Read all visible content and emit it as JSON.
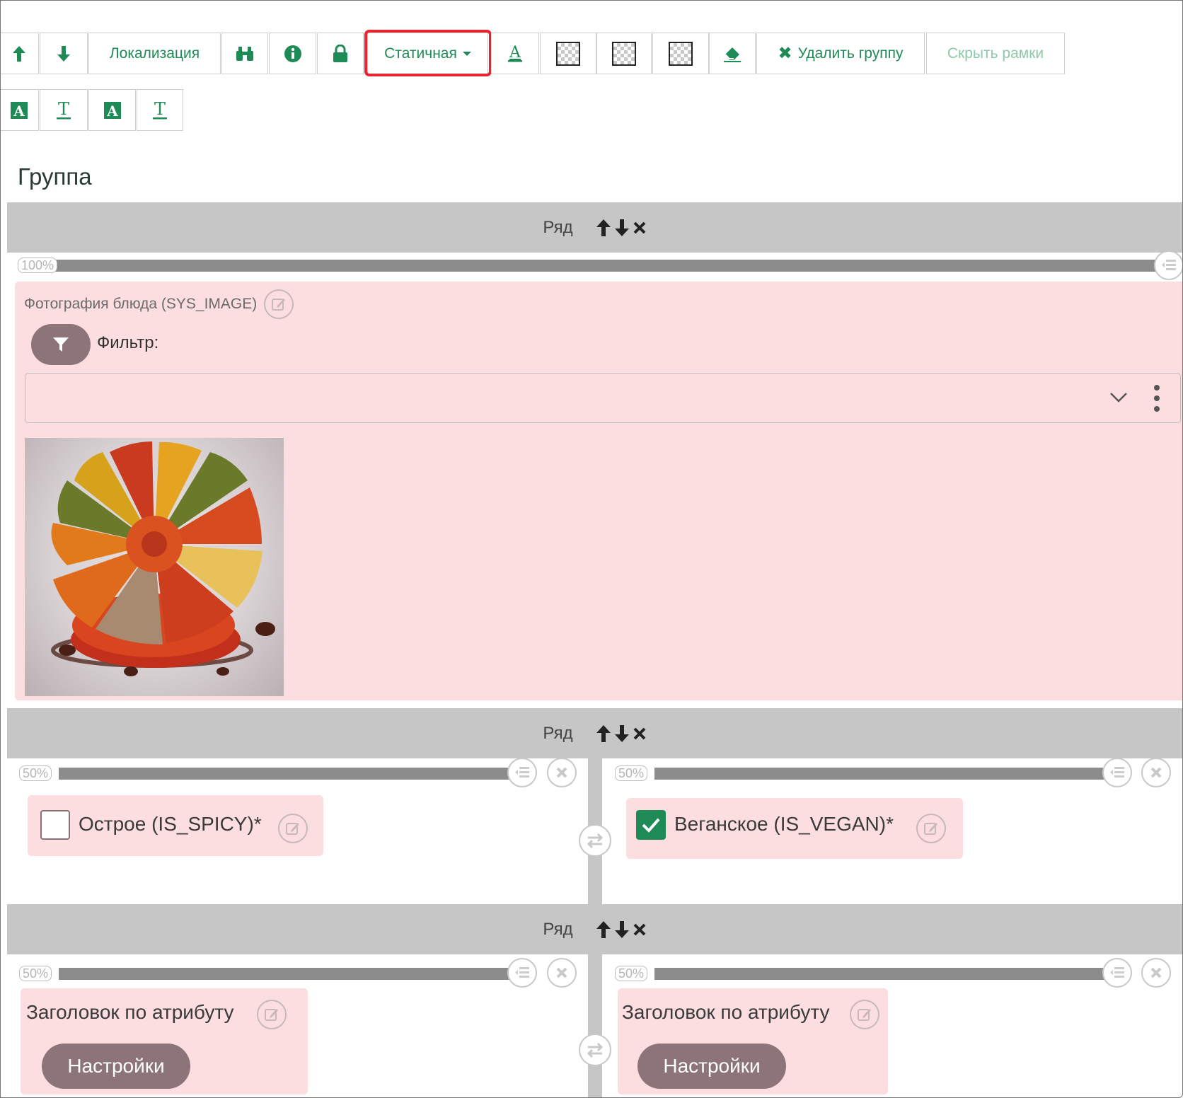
{
  "toolbar": {
    "localization_label": "Локализация",
    "static_label": "Статичная",
    "delete_group_label": "Удалить группу",
    "hide_frames_label": "Скрыть рамки"
  },
  "group": {
    "title": "Группа"
  },
  "rows": [
    {
      "label": "Ряд",
      "columns": [
        {
          "width_label": "100%",
          "field_label": "Фотография блюда (SYS_IMAGE)",
          "filter_label": "Фильтр:",
          "select_value": ""
        }
      ]
    },
    {
      "label": "Ряд",
      "columns": [
        {
          "width_label": "50%",
          "checkbox_label": "Острое (IS_SPICY)*",
          "checked": false
        },
        {
          "width_label": "50%",
          "checkbox_label": "Веганское (IS_VEGAN)*",
          "checked": true
        }
      ]
    },
    {
      "label": "Ряд",
      "columns": [
        {
          "width_label": "50%",
          "heading_label": "Заголовок по атрибуту",
          "settings_label": "Настройки"
        },
        {
          "width_label": "50%",
          "heading_label": "Заголовок по атрибуту",
          "settings_label": "Настройки"
        }
      ]
    }
  ],
  "colors": {
    "accent_green": "#1e8a56",
    "highlight_red": "#e8242e",
    "row_header_gray": "#c6c6c6",
    "field_pink": "#fcdde0",
    "pill_mauve": "#8c7479"
  }
}
